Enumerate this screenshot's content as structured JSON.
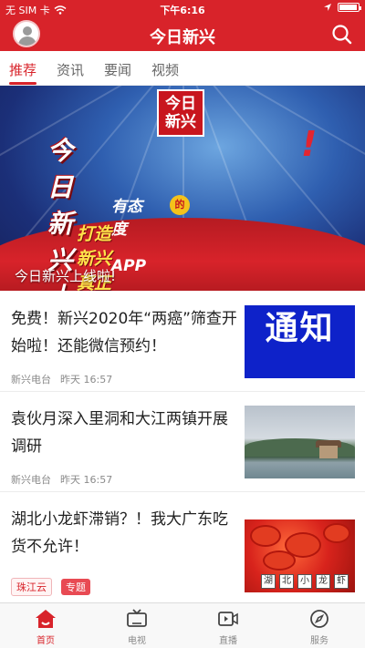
{
  "status_bar": {
    "carrier": "无 SIM 卡",
    "time": "下午6:16"
  },
  "header": {
    "title": "今日新兴"
  },
  "tabs": [
    {
      "label": "推荐",
      "active": true
    },
    {
      "label": "资讯",
      "active": false
    },
    {
      "label": "要闻",
      "active": false
    },
    {
      "label": "视频",
      "active": false
    }
  ],
  "banner": {
    "logo_text_line1": "今日",
    "logo_text_line2": "新兴",
    "headline": "今日新兴上线啦",
    "headline_mark": "!",
    "slogan1_a": "有态度",
    "slogan1_badge": "的",
    "slogan1_b": "APP",
    "slogan2": "打造新兴真正的融媒APP",
    "caption": "今日新兴上线啦!"
  },
  "news": [
    {
      "title": "免费！新兴2020年“两癌”筛查开始啦！还能微信预约！",
      "source": "新兴电台",
      "time": "昨天 16:57",
      "thumb_text": "通知"
    },
    {
      "title": "袁伙月深入里洞和大江两镇开展调研",
      "source": "新兴电台",
      "time": "昨天 16:57"
    },
    {
      "title": "湖北小龙虾滞销？！我大广东吃货不允许！",
      "tags": [
        "珠江云",
        "专题"
      ],
      "thumb_strip": [
        "湖",
        "北",
        "小",
        "龙",
        "虾"
      ]
    }
  ],
  "tabbar": [
    {
      "label": "首页",
      "icon": "home-icon",
      "active": true
    },
    {
      "label": "电视",
      "icon": "tv-icon",
      "active": false
    },
    {
      "label": "直播",
      "icon": "live-icon",
      "active": false
    },
    {
      "label": "服务",
      "icon": "compass-icon",
      "active": false
    }
  ],
  "colors": {
    "brand_red": "#d8232a",
    "notice_blue": "#0e22c9"
  }
}
